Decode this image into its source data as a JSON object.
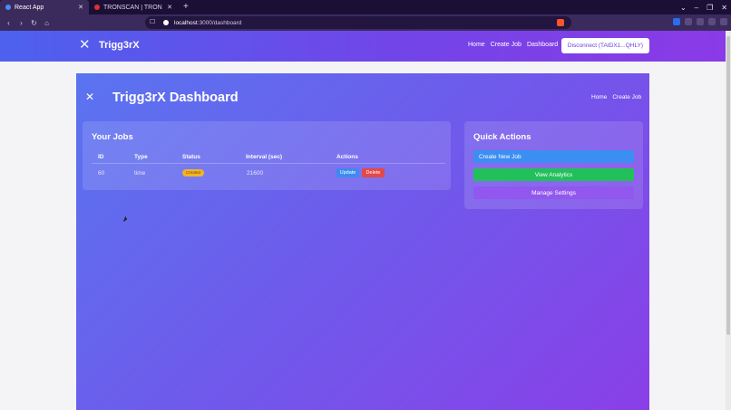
{
  "browser": {
    "tabs": [
      {
        "title": "React App",
        "active": true,
        "favicon_color": "#4c8bf5"
      },
      {
        "title": "TRONSCAN | TRON BlockCh",
        "active": false,
        "favicon_color": "#e0312b"
      }
    ],
    "new_tab": "+",
    "url_host": "localhost",
    "url_path": ":3000/dashboard"
  },
  "app": {
    "brand": "Trigg3rX",
    "nav": {
      "home": "Home",
      "create_job": "Create Job",
      "dashboard": "Dashboard"
    },
    "wallet_button": "Disconnect (TAtDX1...QHLY)"
  },
  "dashboard": {
    "title": "Trigg3rX Dashboard",
    "nav": {
      "home": "Home",
      "create_job": "Create Job"
    },
    "jobs": {
      "title": "Your Jobs",
      "columns": {
        "id": "ID",
        "type": "Type",
        "status": "Status",
        "interval": "Interval (sec)",
        "actions": "Actions"
      },
      "rows": [
        {
          "id": "60",
          "type": "time",
          "status": "Created",
          "interval": "21600",
          "update": "Update",
          "delete": "Delete"
        }
      ]
    },
    "quick_actions": {
      "title": "Quick Actions",
      "create": "Create New Job",
      "analytics": "View Analytics",
      "settings": "Manage Settings"
    }
  },
  "colors": {
    "accent_blue": "#3b8ef2",
    "accent_green": "#22c05a",
    "accent_purple": "#9157ee",
    "status_created": "#f0b429",
    "danger": "#e54848"
  }
}
